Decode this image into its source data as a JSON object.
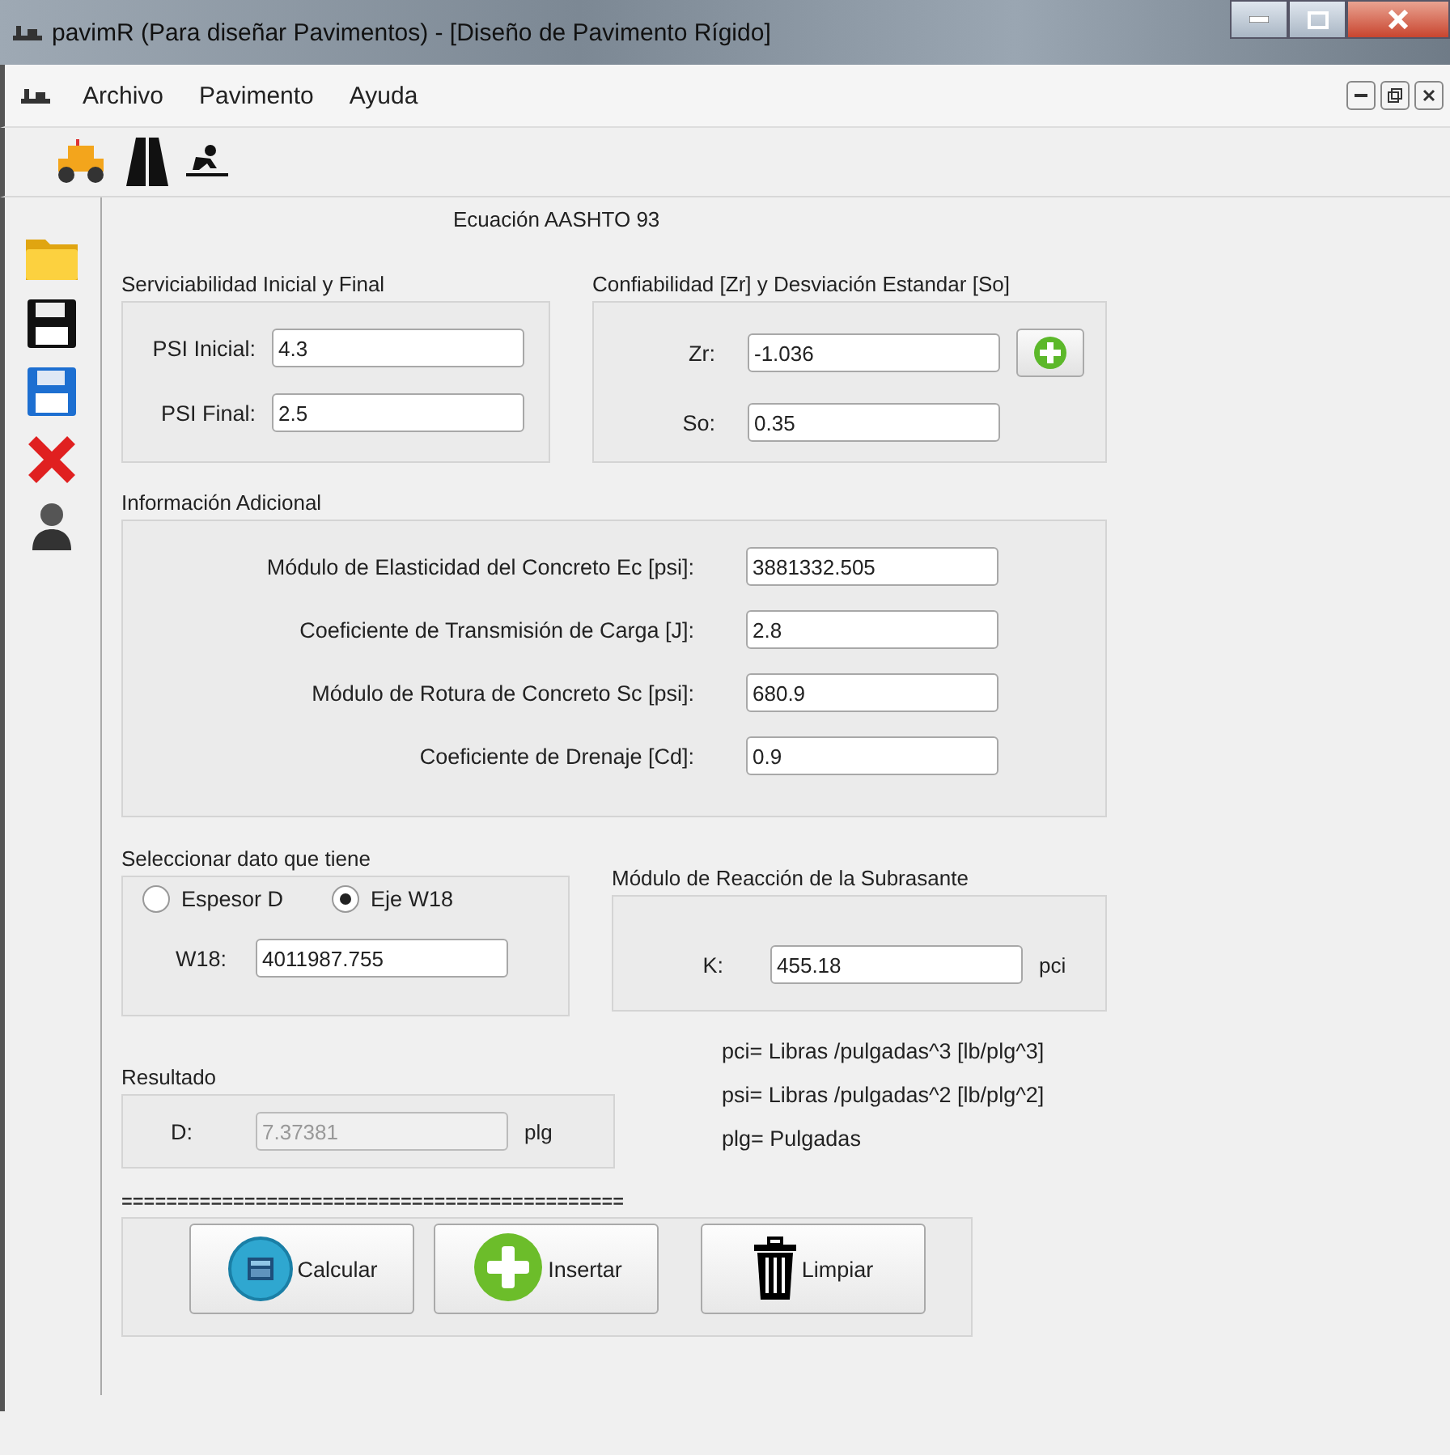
{
  "window": {
    "title": "pavimR (Para diseñar Pavimentos) - [Diseño de Pavimento Rígido]"
  },
  "menu": [
    {
      "label": "Archivo"
    },
    {
      "label": "Pavimento"
    },
    {
      "label": "Ayuda"
    }
  ],
  "form": {
    "heading": "Ecuación AASHTO 93",
    "serviceability": {
      "title": "Serviciabilidad Inicial y Final",
      "fields": [
        {
          "label": "PSI Inicial:",
          "value": "4.3"
        },
        {
          "label": "PSI Final:",
          "value": "2.5"
        }
      ]
    },
    "reliability": {
      "title": "Confiabilidad [Zr] y Desviación Estandar [So]",
      "fields": [
        {
          "label": "Zr:",
          "value": "-1.036"
        },
        {
          "label": "So:",
          "value": "0.35"
        }
      ]
    },
    "additional": {
      "title": "Información Adicional",
      "fields": [
        {
          "label": "Módulo de  Elasticidad del Concreto Ec [psi]:",
          "value": "3881332.505"
        },
        {
          "label": "Coeficiente de Transmisión de Carga [J]:",
          "value": "2.8"
        },
        {
          "label": "Módulo de Rotura de Concreto  Sc [psi]:",
          "value": "680.9"
        },
        {
          "label": "Coeficiente de Drenaje [Cd]:",
          "value": "0.9"
        }
      ]
    },
    "select": {
      "title": "Seleccionar  dato que tiene",
      "options": [
        {
          "label": "Espesor D",
          "selected": false
        },
        {
          "label": "Eje W18",
          "selected": true
        }
      ],
      "field": {
        "label": "W18:",
        "value": "4011987.755"
      }
    },
    "subgrade": {
      "title": "Módulo de Reacción de la Subrasante",
      "field": {
        "label": "K:",
        "value": "455.18"
      },
      "unit": "pci"
    },
    "result": {
      "title": "Resultado",
      "field": {
        "label": "D:",
        "value": "7.37381",
        "disabled": true
      },
      "unit": "plg"
    },
    "notes": [
      "pci= Libras /pulgadas^3 [lb/plg^3]",
      "psi= Libras /pulgadas^2 [lb/plg^2]",
      "plg= Pulgadas"
    ],
    "separator": "=============================================",
    "buttons": [
      {
        "label": "Calcular",
        "kind": "calculate"
      },
      {
        "label": "Insertar",
        "kind": "insert"
      },
      {
        "label": "Limpiar",
        "kind": "clear"
      }
    ]
  }
}
